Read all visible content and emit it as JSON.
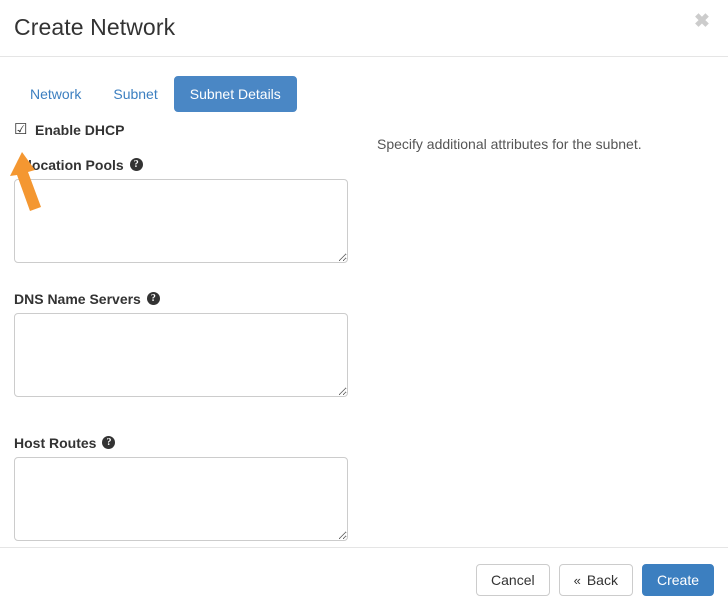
{
  "window": {
    "title": "Create Network",
    "close_icon": "close-icon",
    "close_glyph": "✖"
  },
  "tabs": [
    {
      "label": "Network",
      "active": false
    },
    {
      "label": "Subnet",
      "active": false
    },
    {
      "label": "Subnet Details",
      "active": true
    }
  ],
  "form": {
    "enable_dhcp": {
      "label": "Enable DHCP",
      "checked": true,
      "glyph": "☑"
    },
    "fields": [
      {
        "label": "Allocation Pools",
        "help_glyph": "?",
        "value": "",
        "placeholder": ""
      },
      {
        "label": "DNS Name Servers",
        "help_glyph": "?",
        "value": "",
        "placeholder": ""
      },
      {
        "label": "Host Routes",
        "help_glyph": "?",
        "value": "",
        "placeholder": ""
      }
    ]
  },
  "help_panel": {
    "text": "Specify additional attributes for the subnet."
  },
  "footer": {
    "cancel_label": "Cancel",
    "back_label": "Back",
    "back_chevron": "«",
    "create_label": "Create"
  },
  "annotation": {
    "arrow_color": "#F49731",
    "points_at": "enable-dhcp-checkbox"
  },
  "colors": {
    "accent_blue": "#3c7fc0",
    "active_tab_blue": "#4a87c5",
    "border_gray": "#cccccc",
    "divider_gray": "#e5e5e5",
    "text_dark": "#333333",
    "close_gray": "#cccccc",
    "annotation_orange": "#F49731"
  }
}
